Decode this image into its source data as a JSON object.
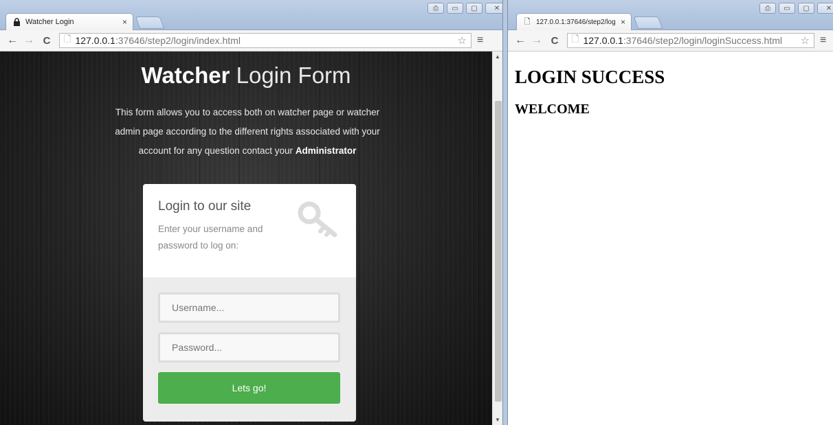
{
  "left_window": {
    "tab_title": "Watcher Login",
    "tab_close": "×",
    "url_host": "127.0.0.1",
    "url_rest": ":37646/step2/login/index.html",
    "menu_glyph": "≡",
    "star_glyph": "☆",
    "window_buttons": [
      "⎙",
      "▭",
      "▢",
      "✕"
    ],
    "page": {
      "title_bold": "Watcher",
      "title_light": "Login Form",
      "intro_text": "This form allows you to access both on watcher page or watcher admin page according to the different rights associated with your account for any question contact your",
      "intro_bold": "Administrator",
      "card_title": "Login to our site",
      "card_subtitle": "Enter your username and password to log on:",
      "username_placeholder": "Username...",
      "password_placeholder": "Password...",
      "submit_label": "Lets go!"
    }
  },
  "right_window": {
    "tab_title": "127.0.0.1:37646/step2/log",
    "tab_close": "×",
    "url_host": "127.0.0.1",
    "url_rest": ":37646/step2/login/loginSuccess.html",
    "menu_glyph": "≡",
    "star_glyph": "☆",
    "window_buttons": [
      "⎙",
      "▭",
      "▢",
      "✕"
    ],
    "page": {
      "heading": "LOGIN SUCCESS",
      "subheading": "WELCOME"
    }
  },
  "colors": {
    "submit_button": "#4cae4c",
    "page_background_left": "#222222",
    "chrome_frame": "#a9bedb"
  }
}
